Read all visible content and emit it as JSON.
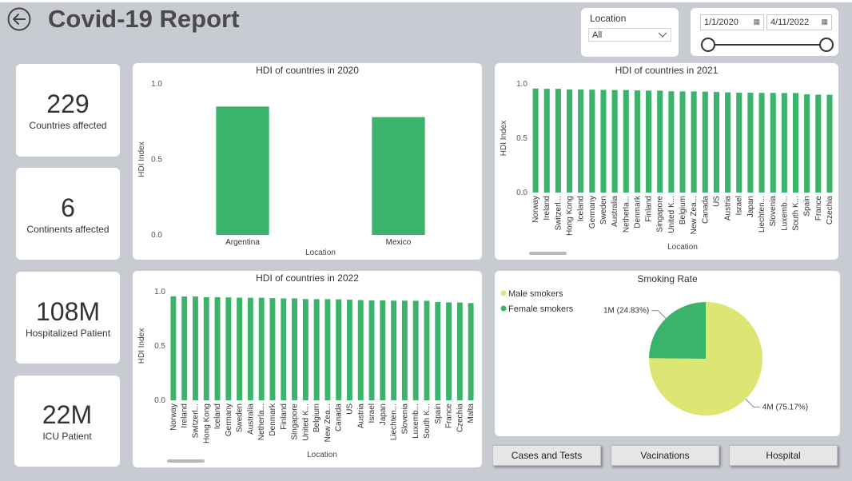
{
  "page": {
    "title": "Covid-19 Report"
  },
  "kpis": [
    {
      "value": "229",
      "label": "Countries affected"
    },
    {
      "value": "6",
      "label": "Continents affected"
    },
    {
      "value": "108M",
      "label": "Hospitalized Patient"
    },
    {
      "value": "22M",
      "label": "ICU Patient"
    }
  ],
  "filters": {
    "location_label": "Location",
    "location_value": "All",
    "date_start": "1/1/2020",
    "date_end": "4/11/2022",
    "date_range_fraction": [
      0,
      1
    ]
  },
  "nav": {
    "cases": "Cases and Tests",
    "vaccinations": "Vacinations",
    "hospital": "Hospital"
  },
  "colors": {
    "bar": "#3bb36b",
    "male_smokers": "#dde673",
    "female_smokers": "#3bb36b",
    "background": "#c8cbd1"
  },
  "chart_data": [
    {
      "id": "hdi2020",
      "type": "bar",
      "title": "HDI of countries in 2020",
      "xlabel": "Location",
      "ylabel": "HDI Index",
      "ylim": [
        0,
        1
      ],
      "yticks": [
        "0.0",
        "0.5",
        "1.0"
      ],
      "categories": [
        "Argentina",
        "Mexico"
      ],
      "values": [
        0.85,
        0.78
      ]
    },
    {
      "id": "hdi2021",
      "type": "bar",
      "title": "HDI of countries in 2021",
      "xlabel": "Location",
      "ylabel": "HDI Index",
      "ylim": [
        0,
        1
      ],
      "yticks": [
        "0.0",
        "0.5",
        "1.0"
      ],
      "categories": [
        "Norway",
        "Ireland",
        "Switzerl...",
        "Hong Kong",
        "Iceland",
        "Germany",
        "Sweden",
        "Australia",
        "Netherla...",
        "Denmark",
        "Finland",
        "Singapore",
        "United K...",
        "Belgium",
        "New Zea...",
        "Canada",
        "US",
        "Austria",
        "Israel",
        "Japan",
        "Liechten...",
        "Slovenia",
        "Luxemb...",
        "South K...",
        "Spain",
        "France",
        "Czechia"
      ],
      "values": [
        0.957,
        0.955,
        0.955,
        0.949,
        0.949,
        0.947,
        0.945,
        0.944,
        0.944,
        0.94,
        0.938,
        0.938,
        0.932,
        0.931,
        0.931,
        0.929,
        0.926,
        0.922,
        0.919,
        0.919,
        0.917,
        0.917,
        0.916,
        0.916,
        0.904,
        0.901,
        0.9
      ]
    },
    {
      "id": "hdi2022",
      "type": "bar",
      "title": "HDI of countries in 2022",
      "xlabel": "Location",
      "ylabel": "HDI Index",
      "ylim": [
        0,
        1
      ],
      "yticks": [
        "0.0",
        "0.5",
        "1.0"
      ],
      "categories": [
        "Norway",
        "Ireland",
        "Switzerl...",
        "Hong Kong",
        "Iceland",
        "Germany",
        "Sweden",
        "Australia",
        "Netherla...",
        "Denmark",
        "Finland",
        "Singapore",
        "United K...",
        "Belgium",
        "New Zea...",
        "Canada",
        "US",
        "Austria",
        "Israel",
        "Japan",
        "Liechten...",
        "Slovenia",
        "Luxemb...",
        "South K...",
        "Spain",
        "France",
        "Czechia",
        "Malta"
      ],
      "values": [
        0.957,
        0.955,
        0.955,
        0.949,
        0.949,
        0.947,
        0.945,
        0.944,
        0.944,
        0.94,
        0.938,
        0.938,
        0.932,
        0.931,
        0.931,
        0.929,
        0.926,
        0.922,
        0.919,
        0.919,
        0.917,
        0.917,
        0.916,
        0.916,
        0.904,
        0.901,
        0.9,
        0.895
      ]
    },
    {
      "id": "smoking",
      "type": "pie",
      "title": "Smoking Rate",
      "legend": [
        "Male smokers",
        "Female smokers"
      ],
      "legend_position": "top-left",
      "slices": [
        {
          "name": "Male smokers",
          "value": 75.17,
          "label": "4M (75.17%)"
        },
        {
          "name": "Female smokers",
          "value": 24.83,
          "label": "1M (24.83%)"
        }
      ]
    }
  ]
}
